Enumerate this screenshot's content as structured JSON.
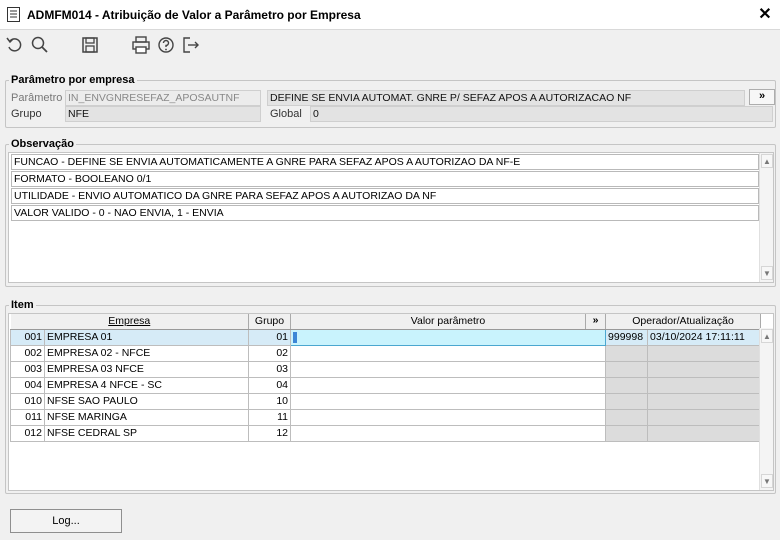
{
  "window": {
    "title": "ADMFM014 - Atribuição de Valor a Parâmetro por Empresa",
    "close_label": "✕"
  },
  "toolbar": {
    "icons": [
      "undo-icon",
      "search-icon",
      "save-icon",
      "print-icon",
      "help-icon",
      "exit-icon"
    ]
  },
  "parametro_section": {
    "legend": "Parâmetro por empresa",
    "parametro_label": "Parâmetro",
    "parametro_value": "IN_ENVGNRESEFAZ_APOSAUTNF",
    "descricao_value": "DEFINE SE ENVIA AUTOMAT. GNRE P/ SEFAZ APOS A AUTORIZACAO NF",
    "more_label": "»",
    "grupo_label": "Grupo",
    "grupo_value": "NFE",
    "global_label": "Global",
    "global_value": "0"
  },
  "observacao": {
    "legend": "Observação",
    "lines": [
      "FUNCAO - DEFINE SE ENVIA AUTOMATICAMENTE A GNRE PARA SEFAZ APOS A AUTORIZAO DA NF-E",
      "FORMATO - BOOLEANO 0/1",
      "UTILIDADE - ENVIO AUTOMATICO DA GNRE PARA SEFAZ APOS A AUTORIZAO DA NF",
      "VALOR VALIDO - 0 - NAO ENVIA, 1 - ENVIA"
    ]
  },
  "item": {
    "legend": "Item",
    "columns": {
      "empresa": "Empresa",
      "grupo": "Grupo",
      "valor": "Valor parâmetro",
      "valor_more": "»",
      "operador": "Operador/Atualização"
    },
    "rows": [
      {
        "code": "001",
        "name": "EMPRESA 01",
        "grupo": "01",
        "valor": "1",
        "operador": "999998",
        "atualizacao": "03/10/2024 17:11:11"
      },
      {
        "code": "002",
        "name": "EMPRESA 02 - NFCE",
        "grupo": "02",
        "valor": "",
        "operador": "",
        "atualizacao": ""
      },
      {
        "code": "003",
        "name": "EMPRESA 03 NFCE",
        "grupo": "03",
        "valor": "",
        "operador": "",
        "atualizacao": ""
      },
      {
        "code": "004",
        "name": "EMPRESA 4 NFCE - SC",
        "grupo": "04",
        "valor": "",
        "operador": "",
        "atualizacao": ""
      },
      {
        "code": "010",
        "name": "NFSE SAO PAULO",
        "grupo": "10",
        "valor": "",
        "operador": "",
        "atualizacao": ""
      },
      {
        "code": "011",
        "name": "NFSE MARINGA",
        "grupo": "11",
        "valor": "",
        "operador": "",
        "atualizacao": ""
      },
      {
        "code": "012",
        "name": "NFSE CEDRAL SP",
        "grupo": "12",
        "valor": "",
        "operador": "",
        "atualizacao": ""
      }
    ]
  },
  "footer": {
    "log_button": "Log..."
  }
}
